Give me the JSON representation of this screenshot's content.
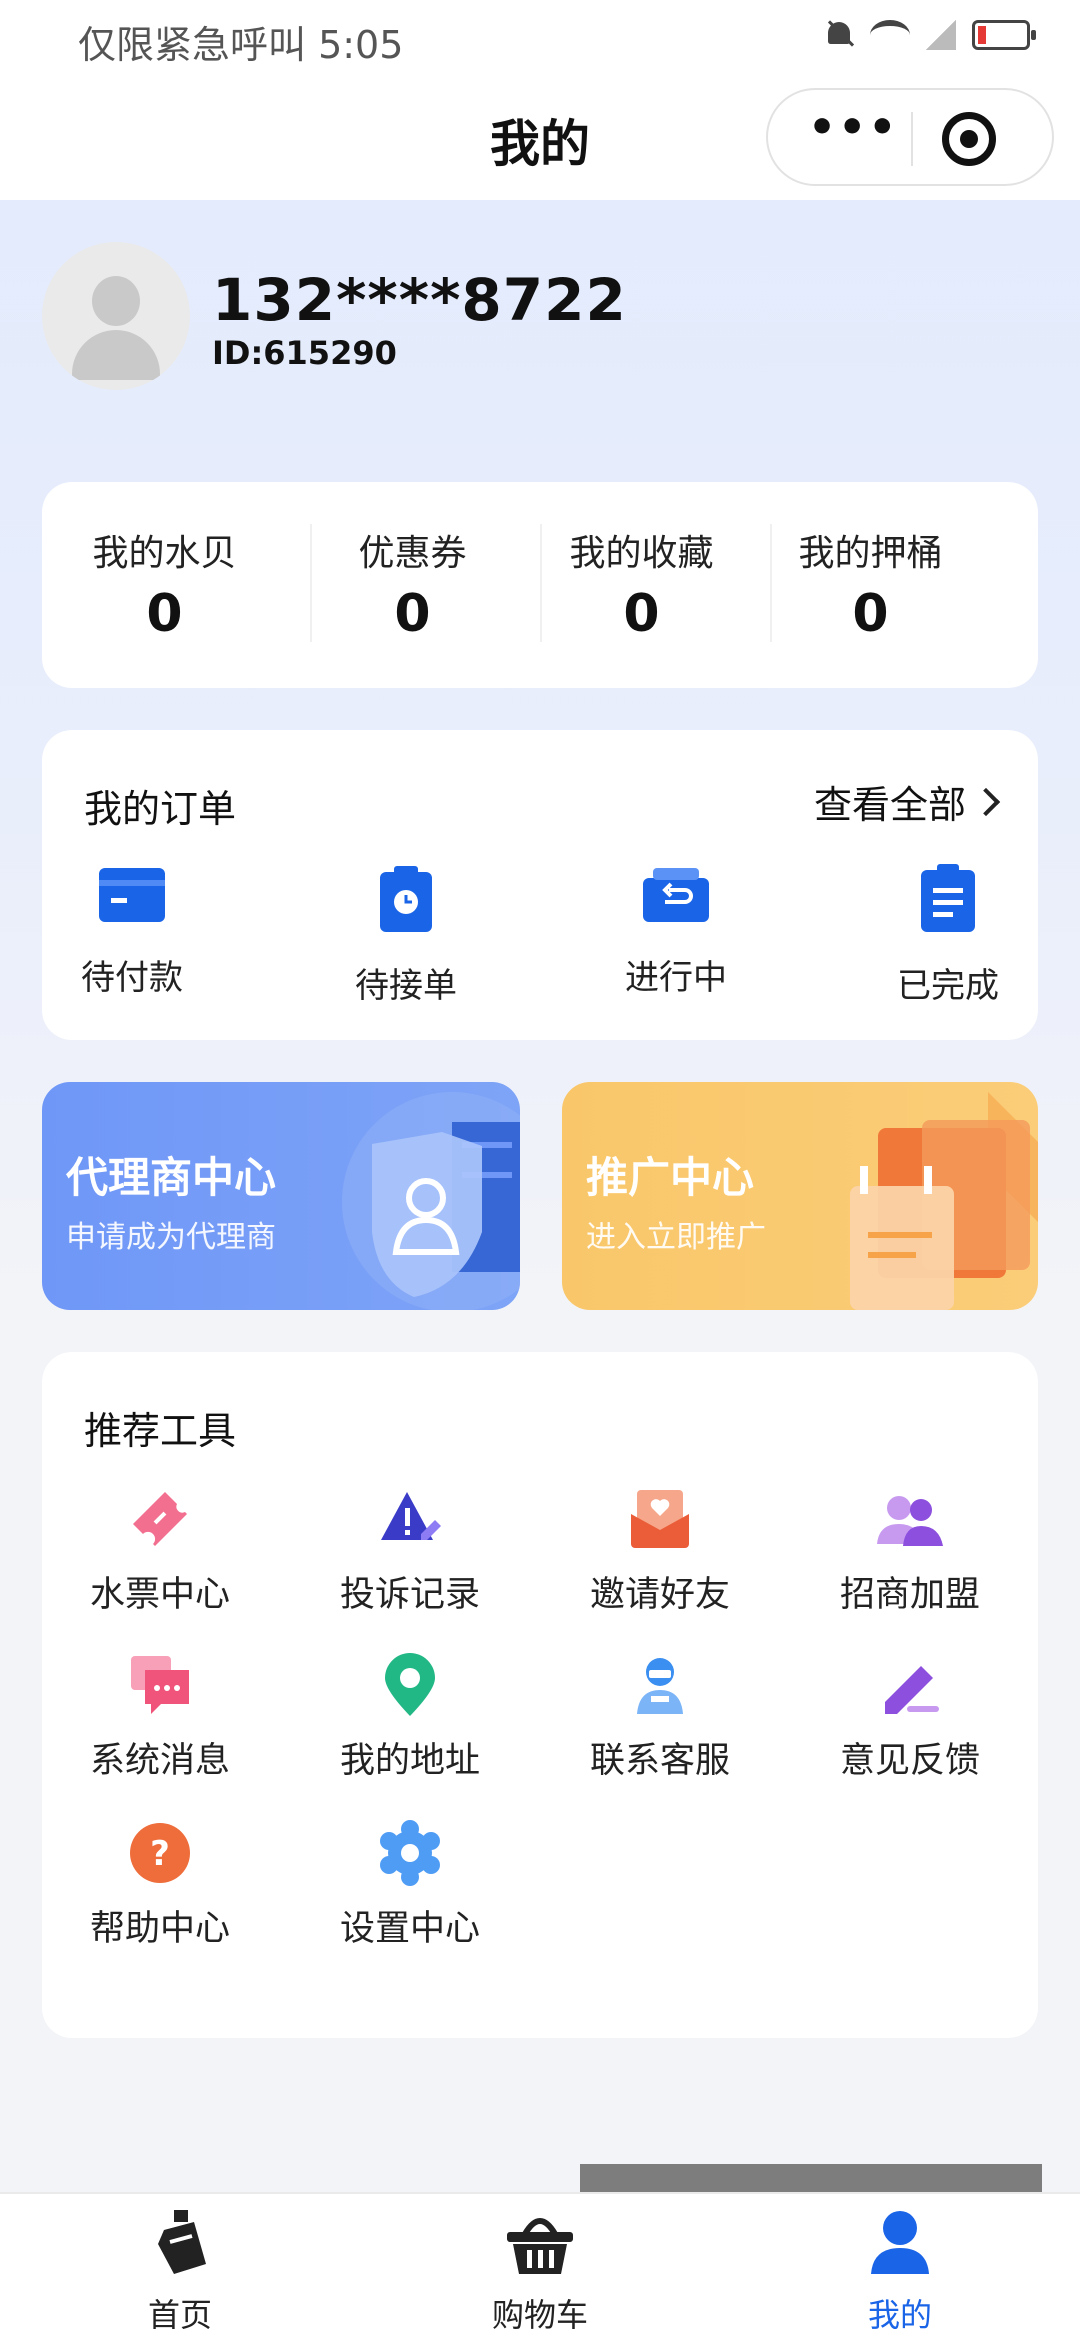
{
  "status_bar": {
    "text": "仅限紧急呼叫 5:05"
  },
  "header": {
    "title": "我的",
    "menu_label": "•••"
  },
  "profile": {
    "phone": "132****8722",
    "id": "ID:615290"
  },
  "stats": [
    {
      "label": "我的水贝",
      "value": "0"
    },
    {
      "label": "优惠券",
      "value": "0"
    },
    {
      "label": "我的收藏",
      "value": "0"
    },
    {
      "label": "我的押桶",
      "value": "0"
    }
  ],
  "orders": {
    "title": "我的订单",
    "view_all": "查看全部",
    "items": [
      {
        "label": "待付款",
        "icon": "wallet-icon"
      },
      {
        "label": "待接单",
        "icon": "clipboard-clock-icon"
      },
      {
        "label": "进行中",
        "icon": "inbox-return-icon"
      },
      {
        "label": "已完成",
        "icon": "document-icon"
      }
    ]
  },
  "promos": {
    "agent": {
      "title": "代理商中心",
      "subtitle": "申请成为代理商"
    },
    "promote": {
      "title": "推广中心",
      "subtitle": "进入立即推广"
    }
  },
  "tools": {
    "title": "推荐工具",
    "items": [
      {
        "label": "水票中心",
        "icon": "ticket-icon"
      },
      {
        "label": "投诉记录",
        "icon": "warning-edit-icon"
      },
      {
        "label": "邀请好友",
        "icon": "envelope-heart-icon"
      },
      {
        "label": "招商加盟",
        "icon": "users-icon"
      },
      {
        "label": "系统消息",
        "icon": "chat-icon"
      },
      {
        "label": "我的地址",
        "icon": "location-pin-icon"
      },
      {
        "label": "联系客服",
        "icon": "service-agent-icon"
      },
      {
        "label": "意见反馈",
        "icon": "pencil-icon"
      },
      {
        "label": "帮助中心",
        "icon": "question-icon"
      },
      {
        "label": "设置中心",
        "icon": "gear-icon"
      }
    ]
  },
  "tabbar": [
    {
      "label": "首页",
      "icon": "bottle-icon"
    },
    {
      "label": "购物车",
      "icon": "basket-icon"
    },
    {
      "label": "我的",
      "icon": "user-icon",
      "active": true
    }
  ],
  "colors": {
    "accent": "#1a64e8",
    "agent_banner": "#6f97f7",
    "promote_banner": "#f9c76a"
  }
}
